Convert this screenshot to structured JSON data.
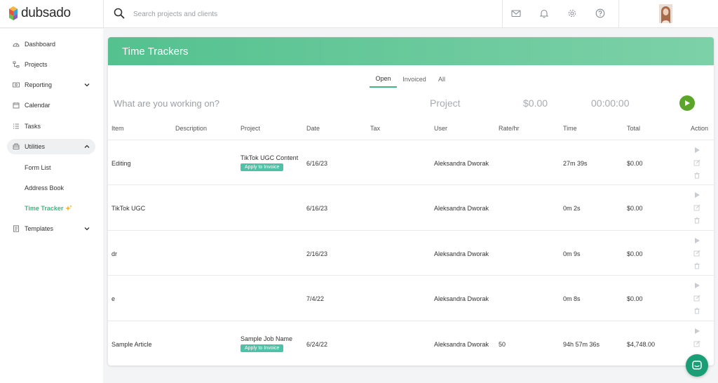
{
  "brand": {
    "name": "dubsado"
  },
  "search": {
    "placeholder": "Search projects and clients"
  },
  "sidebar": {
    "items": [
      {
        "label": "Dashboard"
      },
      {
        "label": "Projects"
      },
      {
        "label": "Reporting"
      },
      {
        "label": "Calendar"
      },
      {
        "label": "Tasks"
      },
      {
        "label": "Utilities"
      },
      {
        "label": "Templates"
      }
    ],
    "utilities_sub": [
      {
        "label": "Form List"
      },
      {
        "label": "Address Book"
      },
      {
        "label": "Time Tracker"
      }
    ]
  },
  "page": {
    "title": "Time Trackers"
  },
  "tabs": [
    {
      "label": "Open"
    },
    {
      "label": "Invoiced"
    },
    {
      "label": "All"
    }
  ],
  "tracker": {
    "placeholder": "What are you working on?",
    "project": "Project",
    "amount": "$0.00",
    "timer": "00:00:00"
  },
  "table": {
    "columns": [
      "Item",
      "Description",
      "Project",
      "Date",
      "Tax",
      "User",
      "Rate/hr",
      "Time",
      "Total",
      "Action"
    ],
    "apply_label": "Apply to Invoice",
    "rows": [
      {
        "item": "Editing",
        "description": "",
        "project": "TikTok UGC Content",
        "date": "6/16/23",
        "tax": "",
        "user": "Aleksandra Dworak",
        "rate": "",
        "time": "27m 39s",
        "total": "$0.00"
      },
      {
        "item": "TikTok UGC",
        "description": "",
        "project": "",
        "date": "6/16/23",
        "tax": "",
        "user": "Aleksandra Dworak",
        "rate": "",
        "time": "0m 2s",
        "total": "$0.00"
      },
      {
        "item": "dr",
        "description": "",
        "project": "",
        "date": "2/16/23",
        "tax": "",
        "user": "Aleksandra Dworak",
        "rate": "",
        "time": "0m 9s",
        "total": "$0.00"
      },
      {
        "item": "e",
        "description": "",
        "project": "",
        "date": "7/4/22",
        "tax": "",
        "user": "Aleksandra Dworak",
        "rate": "",
        "time": "0m 8s",
        "total": "$0.00"
      },
      {
        "item": "Sample Article",
        "description": "",
        "project": "Sample Job Name",
        "date": "6/24/22",
        "tax": "",
        "user": "Aleksandra Dworak",
        "rate": "50",
        "time": "94h 57m 36s",
        "total": "$4,748.00"
      }
    ]
  },
  "colors": {
    "accent": "#3fb684",
    "header_start": "#54c18f",
    "header_end": "#7dd1a8",
    "badge": "#4fc1a6",
    "play": "#5aa52a",
    "chat": "#1a9e76"
  }
}
